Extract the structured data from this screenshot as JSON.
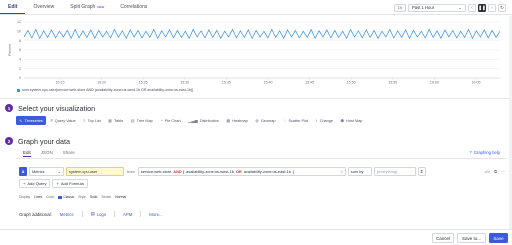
{
  "tabs": [
    {
      "label": "Edit",
      "active": true
    },
    {
      "label": "Overview",
      "active": false
    },
    {
      "label": "Split Graph",
      "badge": "NEW",
      "active": false
    },
    {
      "label": "Correlations",
      "active": false
    }
  ],
  "time_controls": {
    "range_short": "1h",
    "range_label": "Past 1 Hour",
    "dropdown_icon": "chevron-down-icon",
    "back_icon": "step-back-icon",
    "pause_icon": "pause-icon",
    "forward_icon": "step-forward-icon",
    "refresh_icon": "refresh-icon"
  },
  "chart_data": {
    "type": "line",
    "title": "",
    "ylabel": "Percent",
    "ylim": [
      0,
      12
    ],
    "yticks": [
      "12",
      "10",
      "8",
      "6",
      "4",
      "2",
      "0"
    ],
    "x_tick_labels": [
      "15:15",
      "15:20",
      "15:25",
      "15:30",
      "15:35",
      "15:40",
      "15:45",
      "15:50",
      "15:55",
      "16:00",
      "16:05"
    ],
    "series": [
      {
        "name": "sum:system.cpu.user{service:web-store AND (availability-zone:us-west-1b OR availability-zone:us-east-1b)}",
        "color": "#3c8fd5",
        "values": [
          8.8,
          10.2,
          8.6,
          10.4,
          8.5,
          10.1,
          8.7,
          10.3,
          8.6,
          10.0,
          8.8,
          10.2,
          8.5,
          10.4,
          8.6,
          10.1,
          8.7,
          10.3,
          8.5,
          10.2,
          8.8,
          10.0,
          8.6,
          10.4,
          8.7,
          10.1,
          8.5,
          10.3,
          8.8,
          10.2,
          8.6,
          10.0,
          8.7,
          10.4,
          8.5,
          10.1,
          8.8,
          10.3,
          8.6,
          10.2,
          8.7,
          10.0,
          8.5,
          10.4,
          8.8,
          10.1,
          8.6,
          10.3,
          8.7,
          10.2,
          8.5,
          10.0,
          8.8,
          10.4,
          8.6,
          10.1,
          8.7,
          10.3,
          8.5,
          10.2,
          8.8,
          10.0,
          8.6,
          10.4,
          8.7,
          10.1,
          8.5,
          10.3,
          8.8,
          10.2,
          8.6,
          10.0,
          8.7,
          10.4,
          8.5,
          10.1,
          8.8,
          10.3,
          8.6,
          10.2,
          8.7,
          10.0,
          8.5,
          10.4,
          8.8,
          10.1,
          8.6,
          10.3,
          8.7,
          10.2,
          8.5,
          10.0,
          8.8,
          10.4,
          8.6,
          10.1,
          8.7,
          10.3,
          8.5,
          10.2,
          8.8,
          10.0,
          8.6,
          10.4,
          8.7,
          10.1,
          8.5,
          10.3,
          8.8,
          10.2,
          8.6,
          10.0,
          8.7,
          10.4,
          8.5,
          10.1,
          8.8,
          10.3,
          8.6,
          10.2,
          8.7,
          10.0
        ]
      }
    ],
    "grid": true
  },
  "legend_text": "sum:system.cpu.user{service:web-store AND (availability-zone:us-west-1b OR availability-zone:us-east-1b)}",
  "section1": {
    "number": "1",
    "title": "Select your visualization",
    "options": [
      {
        "label": "Timeseries",
        "icon": "timeseries-icon",
        "glyph": "∿",
        "active": true
      },
      {
        "label": "Query Value",
        "icon": "query-value-icon",
        "glyph": "#"
      },
      {
        "label": "Top List",
        "icon": "top-list-icon",
        "glyph": "≡"
      },
      {
        "label": "Table",
        "icon": "table-icon",
        "glyph": "▦"
      },
      {
        "label": "Tree Map",
        "icon": "tree-map-icon",
        "glyph": "▤"
      },
      {
        "label": "Pie Chart",
        "icon": "pie-chart-icon",
        "glyph": "◔"
      },
      {
        "label": "Distribution",
        "icon": "distribution-icon",
        "glyph": "▁▃▅"
      },
      {
        "label": "Heatmap",
        "icon": "heatmap-icon",
        "glyph": "▩"
      },
      {
        "label": "Geomap",
        "icon": "geomap-icon",
        "glyph": "◍"
      },
      {
        "label": "Scatter Plot",
        "icon": "scatter-plot-icon",
        "glyph": "⁘"
      },
      {
        "label": "Change",
        "icon": "change-icon",
        "glyph": "↕"
      },
      {
        "label": "Host Map",
        "icon": "host-map-icon",
        "glyph": "⬢"
      }
    ]
  },
  "section2": {
    "number": "2",
    "title": "Graph your data",
    "subtabs": [
      "Edit",
      "JSON",
      "Share"
    ],
    "help_label": "Graphing help",
    "query": {
      "letter": "a",
      "source": "Metrics",
      "metric": "system.cpu.user",
      "from_word": "from",
      "from_tags": [
        {
          "text": "service:web-store",
          "kind": "tag"
        },
        {
          "text": "AND (",
          "kind": "op"
        },
        {
          "text": "availability-zone:us-west-1b",
          "kind": "tag"
        },
        {
          "text": "OR",
          "kind": "op"
        },
        {
          "text": "availability-zone:us-east-1b",
          "kind": "tag"
        },
        {
          "text": ")",
          "kind": "op"
        }
      ],
      "clear": "×",
      "agg": "sum by",
      "every_placeholder": "(everything)",
      "sigma": "Σ",
      "right_icons": [
        "</>",
        "⧉",
        "···"
      ]
    },
    "add_query": "Add Query",
    "add_formula": "Add Formula",
    "display": {
      "display_label": "Display",
      "display_val": "Lines",
      "color_label": "Color",
      "color_val": "Classic",
      "style_label": "Style",
      "style_val": "Solid",
      "stroke_label": "Stroke",
      "stroke_val": "Normal"
    },
    "graph_additional": {
      "label": "Graph additional:",
      "links": [
        "Metrics",
        "Logs",
        "APM",
        "More..."
      ]
    }
  },
  "footer": {
    "cancel": "Cancel",
    "save_to": "Save to...",
    "save": "Save"
  }
}
